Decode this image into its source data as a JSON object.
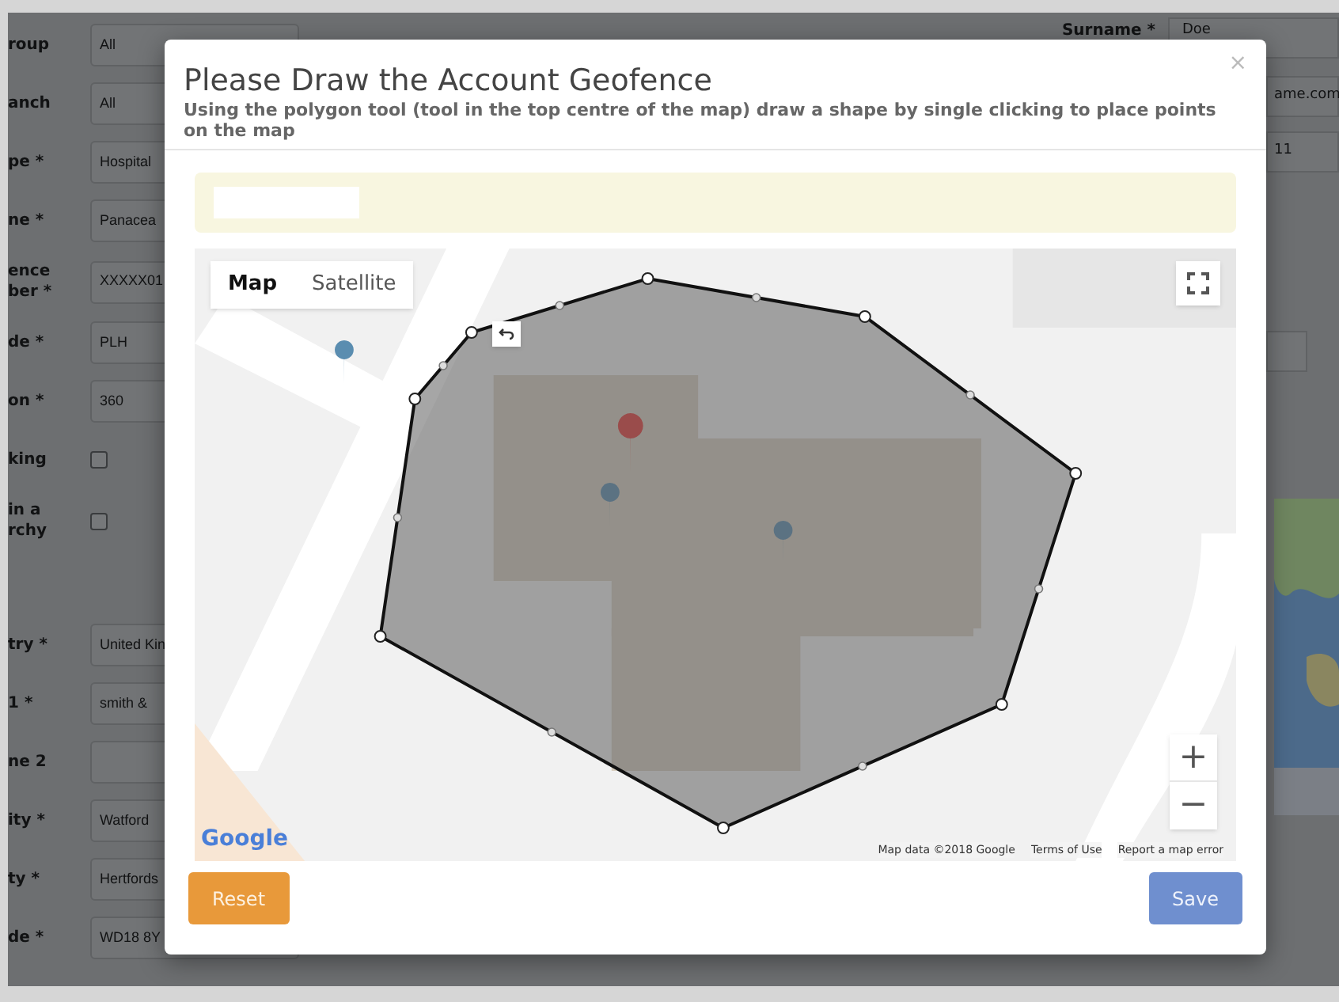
{
  "form_left": [
    {
      "kind": "select",
      "label": "roup",
      "value": "All"
    },
    {
      "kind": "field",
      "label": "anch",
      "value": "All"
    },
    {
      "kind": "field",
      "label": "pe *",
      "value": "Hospital"
    },
    {
      "kind": "field",
      "label": "ne *",
      "value": "Panacea"
    },
    {
      "kind": "field",
      "label": "ence\nber *",
      "value": "XXXXX01"
    },
    {
      "kind": "field",
      "label": "de *",
      "value": "PLH"
    },
    {
      "kind": "field",
      "label": "on *",
      "value": "360"
    },
    {
      "kind": "checkbox",
      "label": "king",
      "checked": false
    },
    {
      "kind": "checkbox",
      "label": "in a\nrchy",
      "checked": false
    },
    {
      "kind": "field",
      "label": "try *",
      "value": "United Kin"
    },
    {
      "kind": "field",
      "label": "1 *",
      "value": "smith & "
    },
    {
      "kind": "field",
      "label": "ne 2"
    },
    {
      "kind": "field",
      "label": "ity *",
      "value": "Watford"
    },
    {
      "kind": "field",
      "label": "ty *",
      "value": "Hertfords"
    },
    {
      "kind": "field",
      "label": "de *",
      "value": "WD18 8Y"
    }
  ],
  "form_right": {
    "surname_label": "Surname *",
    "surname_value": "Doe",
    "fields": [
      "ame.com",
      "11"
    ]
  },
  "modal": {
    "title": "Please Draw the Account Geofence",
    "subtitle": "Using the polygon tool (tool in the top centre of the map) draw a shape by single clicking to place points on the map",
    "close": "×",
    "map": {
      "types": [
        {
          "label": "Map",
          "selected": true
        },
        {
          "label": "Satellite",
          "selected": false
        }
      ],
      "zoom_in": "+",
      "zoom_out": "−",
      "logo": "Google",
      "attribution": [
        "Map data ©2018 Google",
        "Terms of Use",
        "Report a map error"
      ]
    },
    "buttons": [
      {
        "label": "Reset",
        "kind": "warning"
      },
      {
        "label": "Save",
        "kind": "primary"
      }
    ]
  }
}
